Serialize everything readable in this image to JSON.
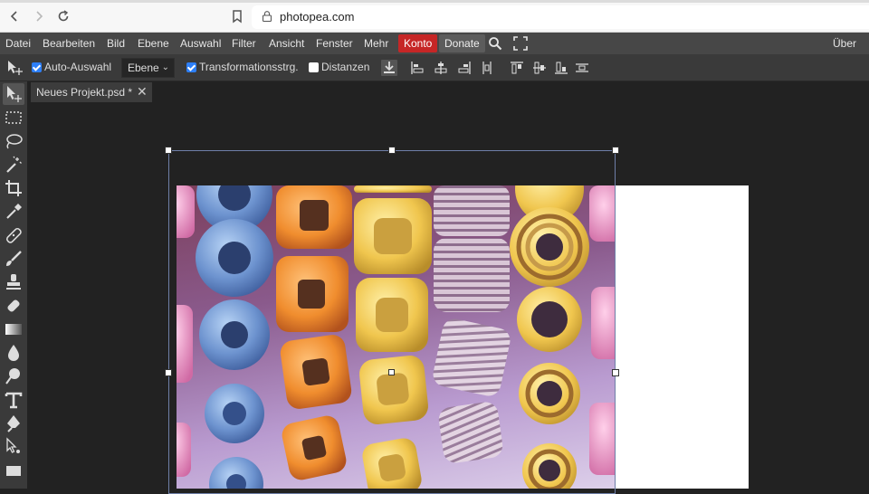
{
  "browser": {
    "url": "photopea.com"
  },
  "menu": {
    "items": [
      "Datei",
      "Bearbeiten",
      "Bild",
      "Ebene",
      "Auswahl",
      "Filter",
      "Ansicht",
      "Fenster",
      "Mehr"
    ],
    "konto": "Konto",
    "donate": "Donate",
    "about": "Über"
  },
  "options": {
    "auto_select": {
      "label": "Auto-Auswahl",
      "checked": true
    },
    "layer_select": {
      "value": "Ebene"
    },
    "transform": {
      "label": "Transformationsstrg.",
      "checked": true
    },
    "distances": {
      "label": "Distanzen",
      "checked": false
    }
  },
  "document": {
    "tab_title": "Neues Projekt.psd *"
  },
  "colors": {
    "accent": "#2d7ff9",
    "konto": "#c62626"
  }
}
